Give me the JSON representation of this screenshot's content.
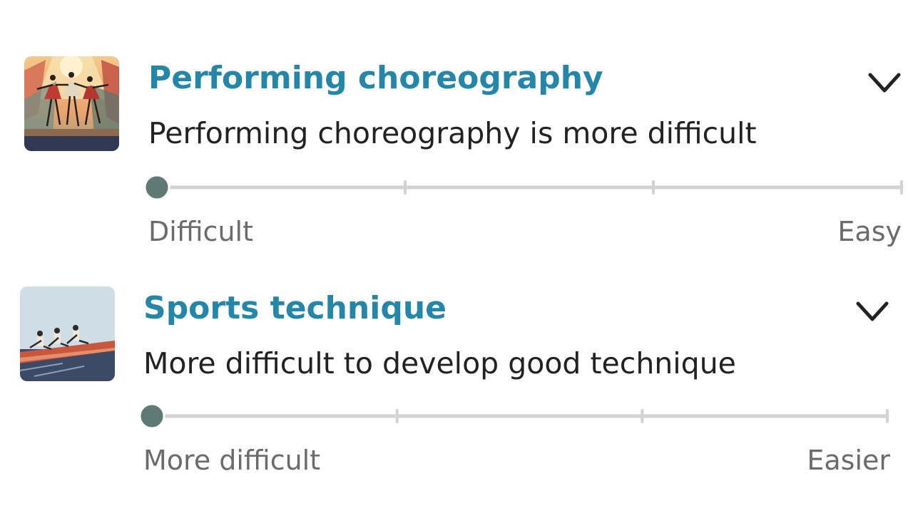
{
  "colors": {
    "title": "#2486a8",
    "subtitle": "#222222",
    "range_label": "#6b6b6b",
    "track": "#d2d2d2",
    "thumb": "#5f7a72"
  },
  "questions": [
    {
      "image_icon": "dancers-illustration",
      "title": "Performing choreography",
      "subtitle": "Performing choreography is more difficult",
      "expand_icon": "chevron-down-icon",
      "slider": {
        "steps": 4,
        "value_index": 0,
        "min_label": "Difficult",
        "max_label": "Easy"
      }
    },
    {
      "image_icon": "rowing-illustration",
      "title": "Sports technique",
      "subtitle": "More difficult to develop good technique",
      "expand_icon": "chevron-down-icon",
      "slider": {
        "steps": 4,
        "value_index": 0,
        "min_label": "More difficult",
        "max_label": "Easier"
      }
    }
  ]
}
